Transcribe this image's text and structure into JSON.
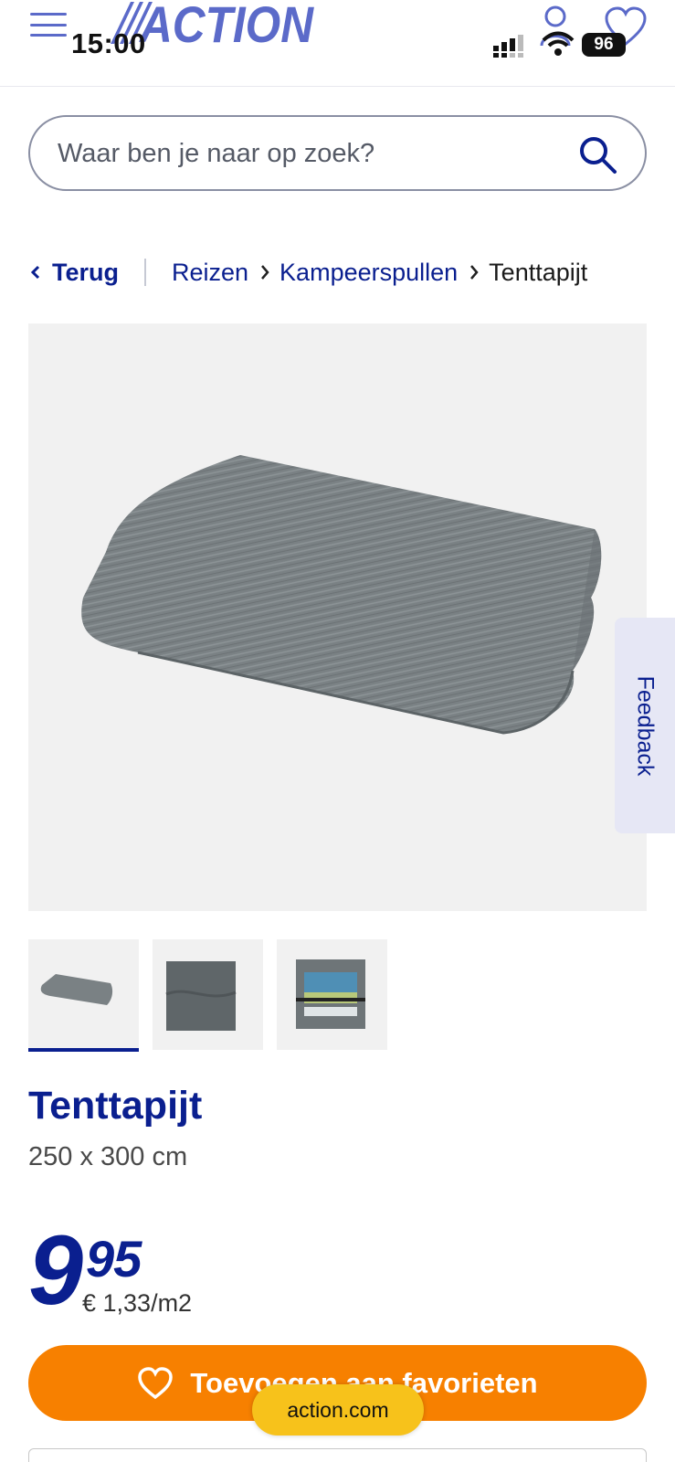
{
  "header": {
    "brand": "ACTION",
    "status": {
      "time": "15:00",
      "battery": "96"
    }
  },
  "search": {
    "placeholder": "Waar ben je naar op zoek?"
  },
  "breadcrumb": {
    "back": "Terug",
    "items": [
      "Reizen",
      "Kampeerspullen"
    ],
    "current": "Tenttapijt"
  },
  "feedback": {
    "label": "Feedback"
  },
  "product": {
    "title": "Tenttapijt",
    "subtitle": "250 x 300 cm",
    "price_int": "9",
    "price_dec": "95",
    "unit_price": "€ 1,33/m2",
    "thumbnails_count": 3,
    "active_thumbnail": 1
  },
  "cta": {
    "favorite_label": "Toevoegen aan favorieten"
  },
  "browser": {
    "url": "action.com"
  },
  "colors": {
    "brand_blue": "#0a1f8f",
    "accent_orange": "#f78000",
    "url_pill": "#f7c21b"
  }
}
